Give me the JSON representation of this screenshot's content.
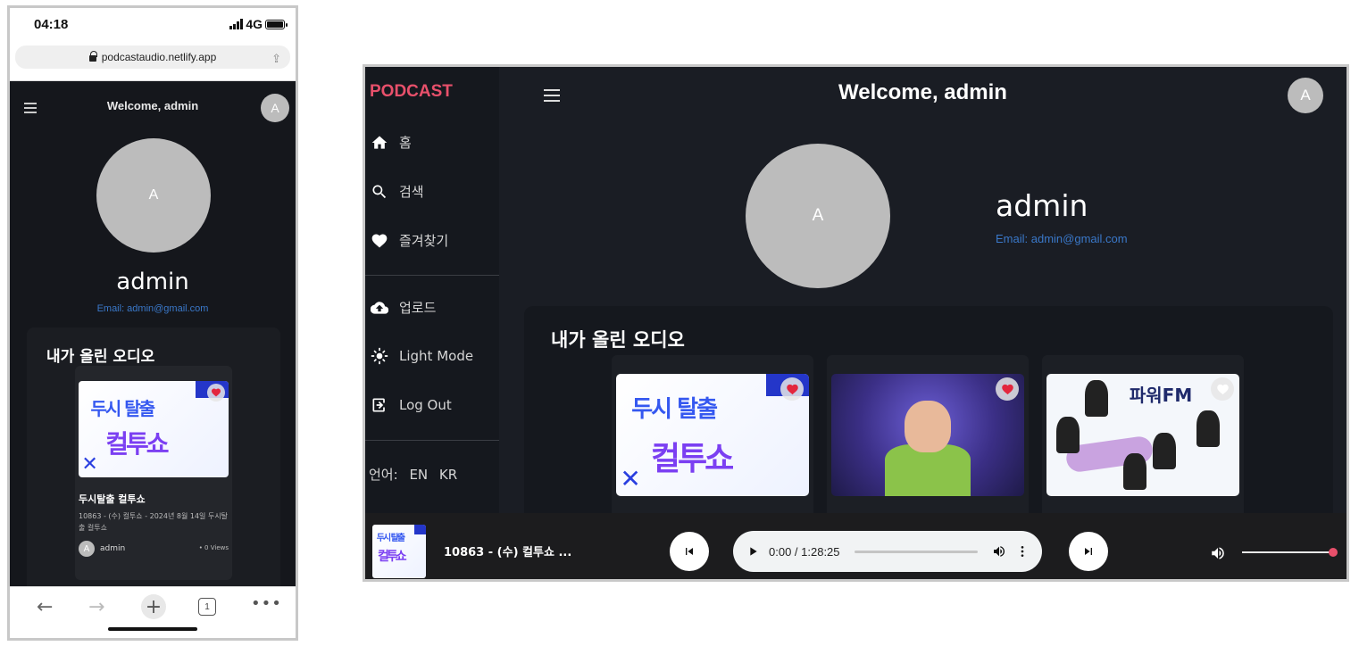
{
  "phone": {
    "status_time": "04:18",
    "network": "4G",
    "url": "podcastaudio.netlify.app",
    "header_title": "Welcome, admin",
    "avatar_letter": "A",
    "profile_avatar_letter": "A",
    "profile_name": "admin",
    "profile_email": "Email: admin@gmail.com",
    "section_title": "내가 올린 오디오",
    "card": {
      "title": "두시탈출 컬투쇼",
      "description": "10863 - (수) 컬투쇼 - 2024년 8월 14일 두시탈출 컬투쇼",
      "author_letter": "A",
      "author": "admin",
      "views": "• 0 Views",
      "liked": true
    },
    "tabs_count": "1"
  },
  "desktop": {
    "logo": "PODCAST",
    "header_title": "Welcome, admin",
    "avatar_letter": "A",
    "nav": [
      {
        "label": "홈",
        "icon": "home-icon"
      },
      {
        "label": "검색",
        "icon": "search-icon"
      },
      {
        "label": "즐겨찾기",
        "icon": "heart-icon"
      },
      {
        "label": "업로드",
        "icon": "cloud-upload-icon"
      },
      {
        "label": "Light Mode",
        "icon": "sun-icon"
      },
      {
        "label": "Log Out",
        "icon": "logout-icon"
      }
    ],
    "language": {
      "label": "언어:",
      "options": [
        "EN",
        "KR"
      ]
    },
    "profile_avatar_letter": "A",
    "profile_name": "admin",
    "profile_email": "Email: admin@gmail.com",
    "section_title": "내가 올린 오디오",
    "cards": [
      {
        "art_text_top": "두시 탈출",
        "art_text_bottom": "컬투쇼",
        "liked": true
      },
      {
        "art_text_top": "",
        "liked": true
      },
      {
        "art_text_top": "파워FM",
        "liked": false
      }
    ],
    "player": {
      "track_title": "10863 - (수) 컬투쇼 ...",
      "time": "0:00 / 1:28:25",
      "progress": 0,
      "volume": 1.0
    },
    "colors": {
      "accent": "#e8506b",
      "link": "#3a78c9",
      "bg": "#1a1d24"
    }
  }
}
